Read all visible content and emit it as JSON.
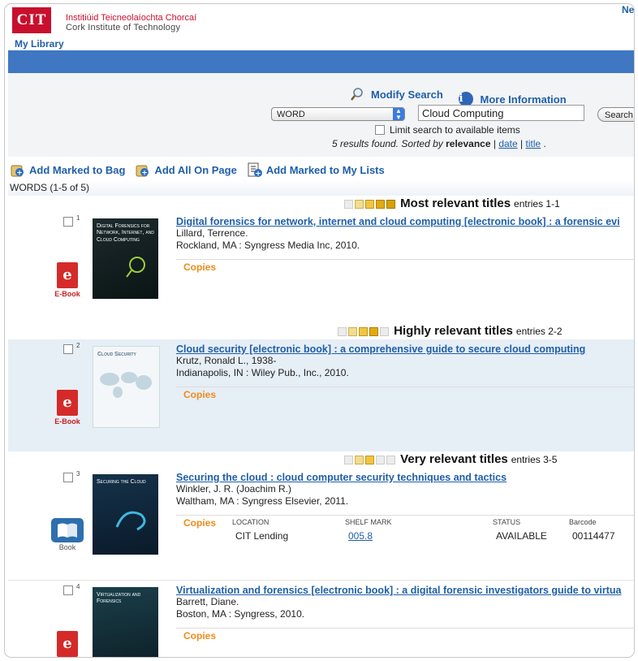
{
  "header": {
    "logo_text": "CIT",
    "logo_line1": "Institiúid Teicneolaíochta Chorcaí",
    "logo_line2": "Cork Institute of Technology",
    "corner_link": "Ne",
    "my_library": "My Library"
  },
  "search": {
    "modify_search": "Modify Search",
    "more_information": "More Information",
    "search_type": "WORD",
    "query": "Cloud Computing",
    "search_button": "Search",
    "limit_label": "Limit search to available items",
    "results_count": "5 results found.",
    "sorted_by_label": "Sorted by",
    "sort_relevance": "relevance",
    "sort_date": "date",
    "sort_title": "title",
    "sort_sep": "|",
    "sort_end": "."
  },
  "toolbar": {
    "add_marked_bag": "Add Marked to Bag",
    "add_all_on_page": "Add All On Page",
    "add_marked_lists": "Add Marked to My Lists"
  },
  "words_label": "WORDS (1-5 of 5)",
  "bands": [
    {
      "label": "Most relevant titles",
      "entries": "entries 1-1"
    },
    {
      "label": "Highly relevant titles",
      "entries": "entries 2-2"
    },
    {
      "label": "Very relevant titles",
      "entries": "entries 3-5"
    }
  ],
  "records": [
    {
      "num": "1",
      "title": "Digital forensics for network, internet and cloud computing [electronic book] : a forensic evi",
      "author": "Lillard, Terrence.",
      "pub": "Rockland, MA : Syngress Media Inc, 2010.",
      "copies": "Copies",
      "format": "E-Book",
      "cover_text": "Digital Forensics for Network, Internet, and Cloud Computing"
    },
    {
      "num": "2",
      "title": "Cloud security [electronic book] : a comprehensive guide to secure cloud computing",
      "author": "Krutz, Ronald L., 1938-",
      "pub": "Indianapolis, IN : Wiley Pub., Inc., 2010.",
      "copies": "Copies",
      "format": "E-Book",
      "cover_text": "Cloud Security"
    },
    {
      "num": "3",
      "title": "Securing the cloud : cloud computer security techniques and tactics",
      "author": "Winkler, J. R. (Joachim R.)",
      "pub": "Waltham, MA : Syngress Elsevier, 2011.",
      "copies": "Copies",
      "format": "Book",
      "cover_text": "Securing the Cloud",
      "holdings": {
        "headers": [
          "LOCATION",
          "SHELF MARK",
          "STATUS",
          "Barcode"
        ],
        "location": "CIT Lending",
        "shelf_mark": "005.8",
        "status": "AVAILABLE",
        "barcode": "00114477"
      }
    },
    {
      "num": "4",
      "title": "Virtualization and forensics [electronic book] : a digital forensic investigators guide to virtua",
      "author": "Barrett, Diane.",
      "pub": "Boston, MA : Syngress, 2010.",
      "copies": "Copies",
      "format": "E-Book",
      "cover_text": "Virtualization and Forensics"
    }
  ],
  "colors": {
    "brand_red": "#c8102e",
    "link_blue": "#1f5fa8",
    "bar_blue": "#3f77c3",
    "copies_orange": "#f08c1a"
  }
}
